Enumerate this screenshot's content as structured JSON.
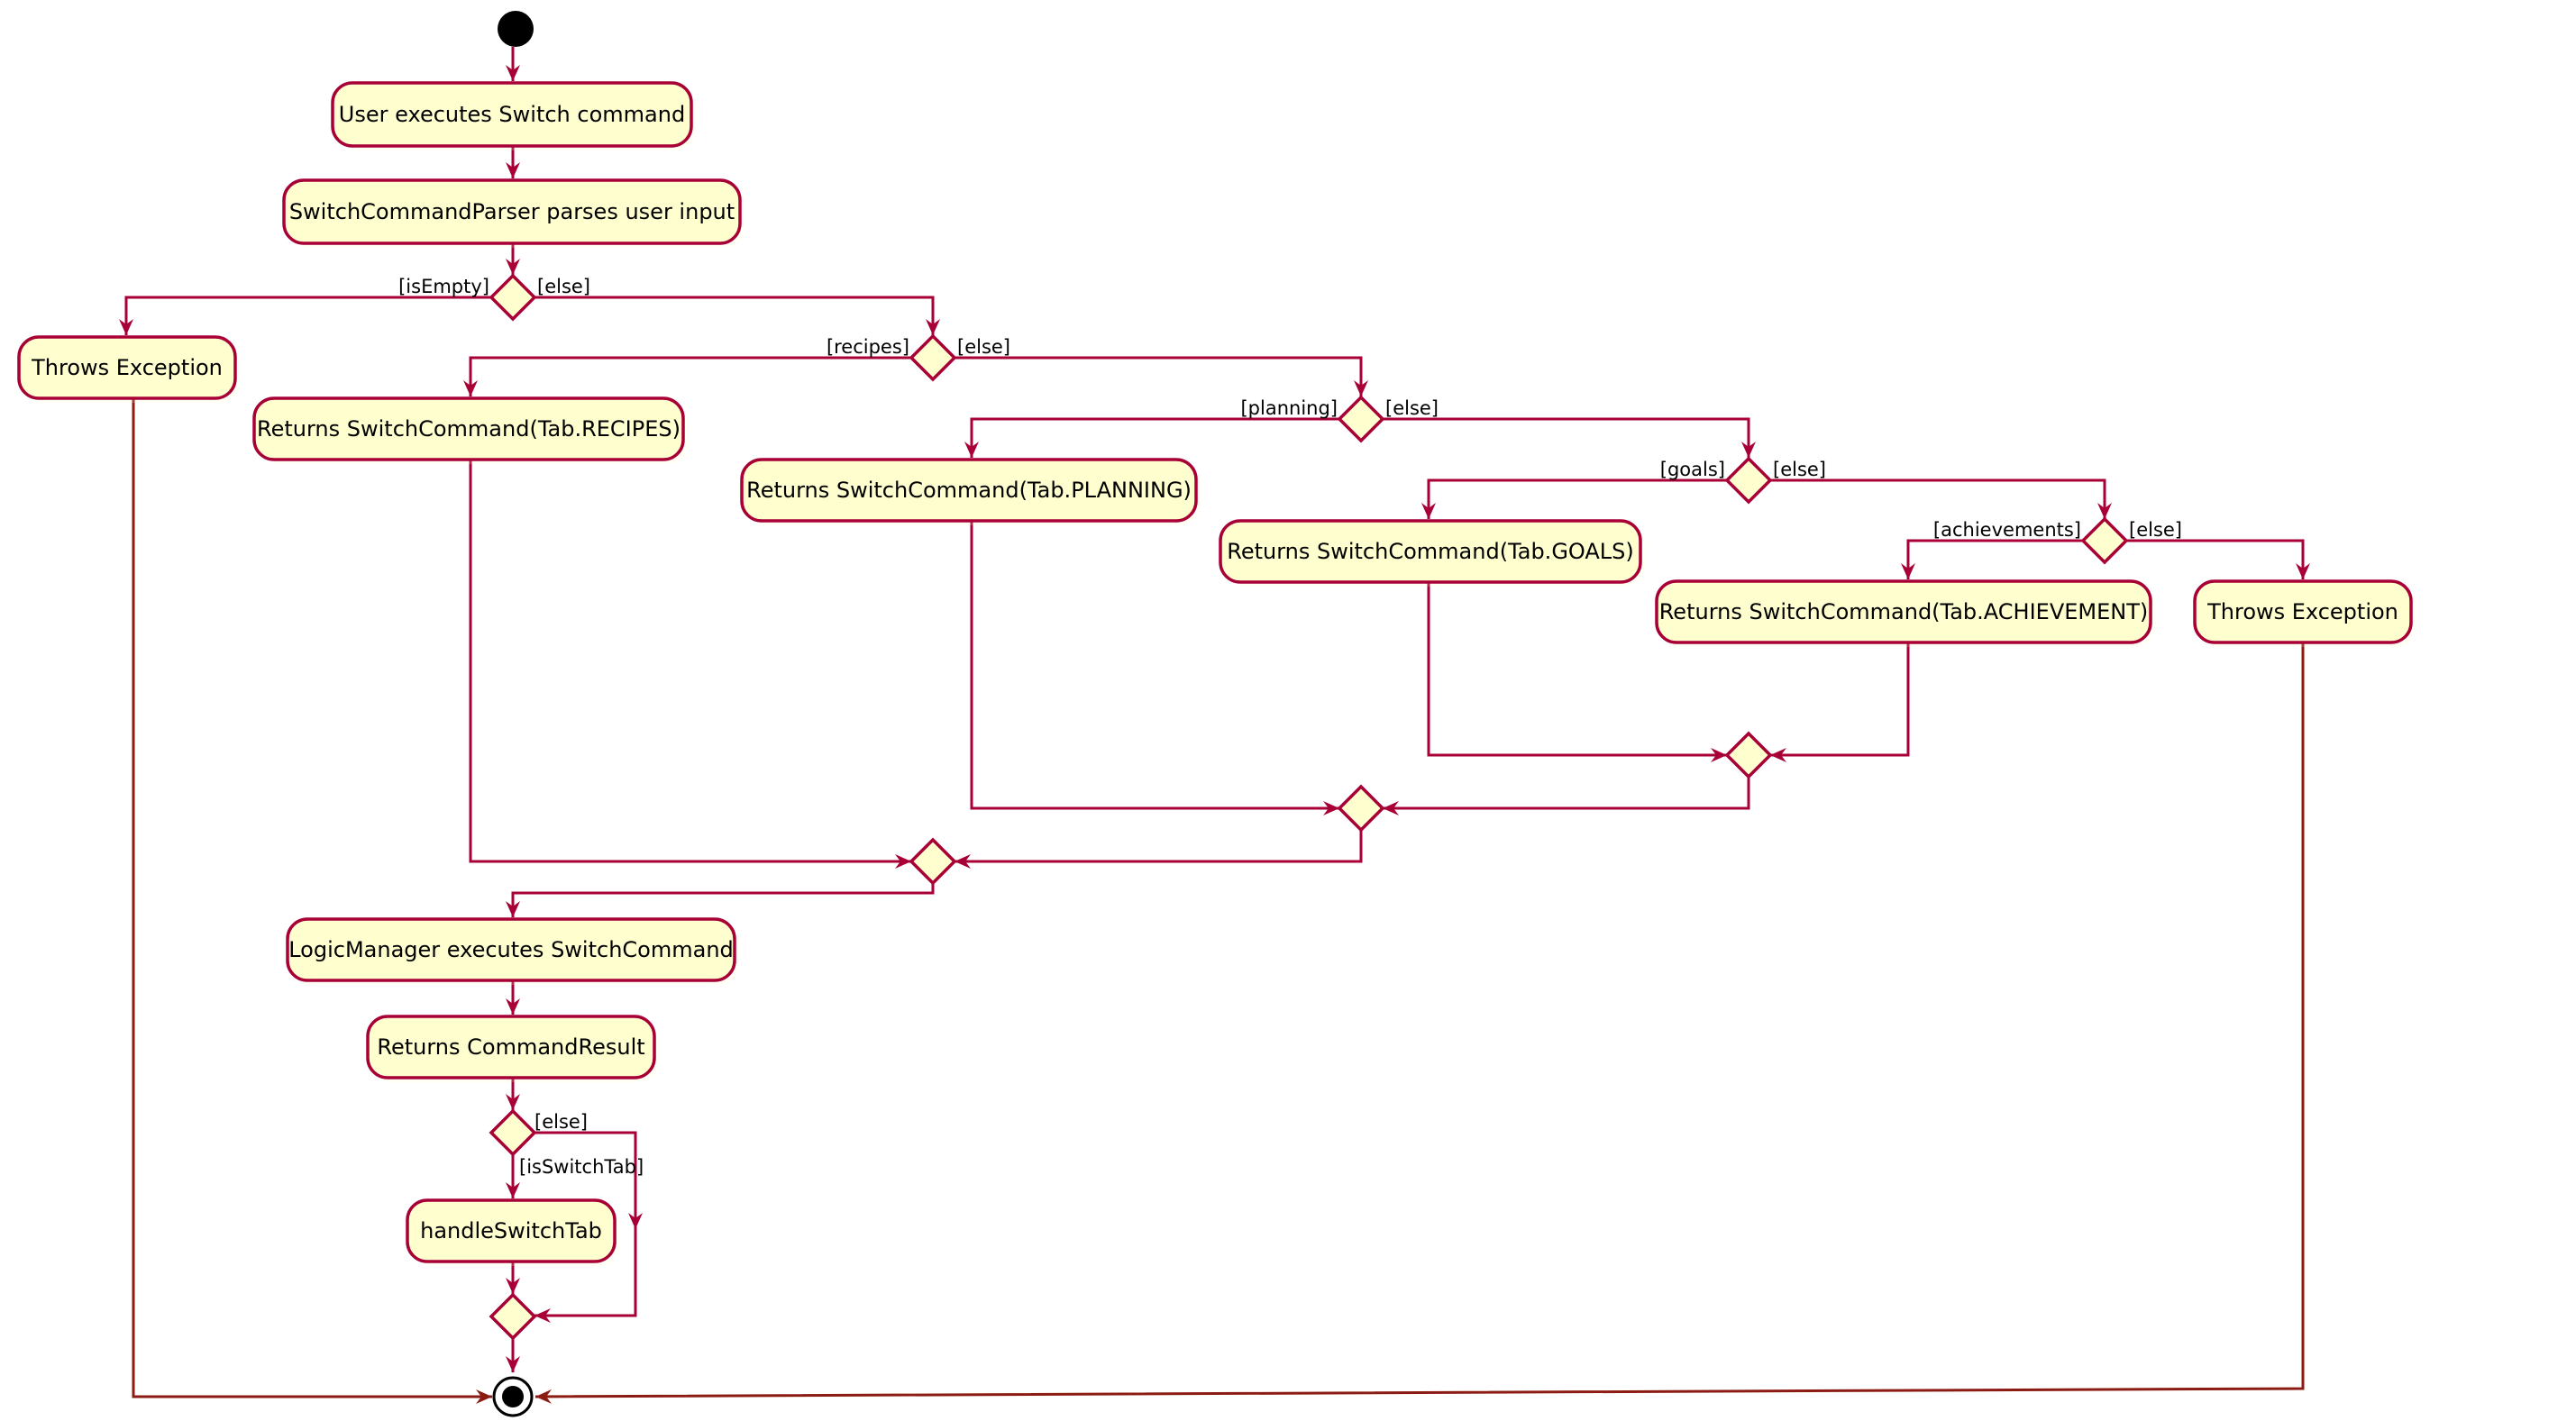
{
  "diagram": {
    "type": "uml-activity",
    "colors": {
      "border": "#A80036",
      "fill": "#FEFECE",
      "final_edge": "#8C1C13"
    },
    "actions": {
      "user_executes": "User executes Switch command",
      "parser_parses": "SwitchCommandParser parses user input",
      "throws_exception_1": "Throws Exception",
      "returns_recipes": "Returns SwitchCommand(Tab.RECIPES)",
      "returns_planning": "Returns SwitchCommand(Tab.PLANNING)",
      "returns_goals": "Returns SwitchCommand(Tab.GOALS)",
      "returns_achievement": "Returns SwitchCommand(Tab.ACHIEVEMENT)",
      "throws_exception_2": "Throws Exception",
      "logic_executes": "LogicManager executes SwitchCommand",
      "returns_result": "Returns CommandResult",
      "handle_switch_tab": "handleSwitchTab"
    },
    "guards": {
      "is_empty": "[isEmpty]",
      "else_1": "[else]",
      "recipes": "[recipes]",
      "else_2": "[else]",
      "planning": "[planning]",
      "else_3": "[else]",
      "goals": "[goals]",
      "else_4": "[else]",
      "achievements": "[achievements]",
      "else_5": "[else]",
      "else_6": "[else]",
      "is_switch_tab": "[isSwitchTab]"
    }
  }
}
